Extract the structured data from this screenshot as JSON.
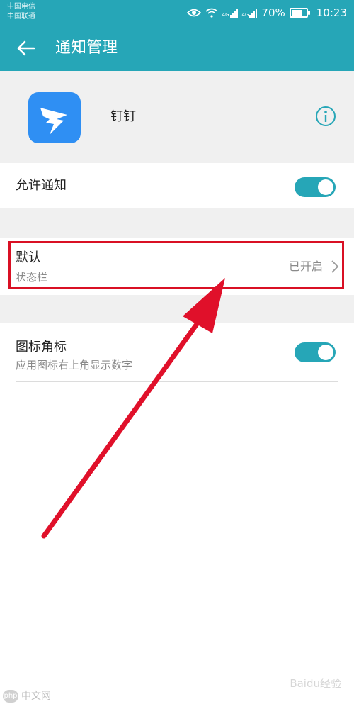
{
  "status_bar": {
    "carrier_1": "中国电信",
    "carrier_2": "中国联通",
    "signal_label_1": "4G",
    "signal_label_2": "4G",
    "battery": "70%",
    "time": "10:23",
    "icons": [
      "eye-icon",
      "wifi-icon",
      "signal-icon",
      "signal-icon",
      "battery-icon"
    ]
  },
  "toolbar": {
    "back_icon": "back-arrow-icon",
    "title": "通知管理"
  },
  "app": {
    "name": "钉钉",
    "icon": "dingtalk-logo",
    "icon_color": "#2f8ff3",
    "info_icon": "info-icon"
  },
  "allow_notification": {
    "label": "允许通知",
    "enabled": true
  },
  "default_channel": {
    "title": "默认",
    "subtitle": "状态栏",
    "value": "已开启",
    "highlighted": true
  },
  "badge": {
    "title": "图标角标",
    "subtitle": "应用图标右上角显示数字",
    "enabled": true
  },
  "colors": {
    "accent": "#26a6b7",
    "highlight": "#d91024"
  },
  "watermark": {
    "left_text": "中文网",
    "left_logo": "php",
    "right_text": "Baidu经验"
  }
}
